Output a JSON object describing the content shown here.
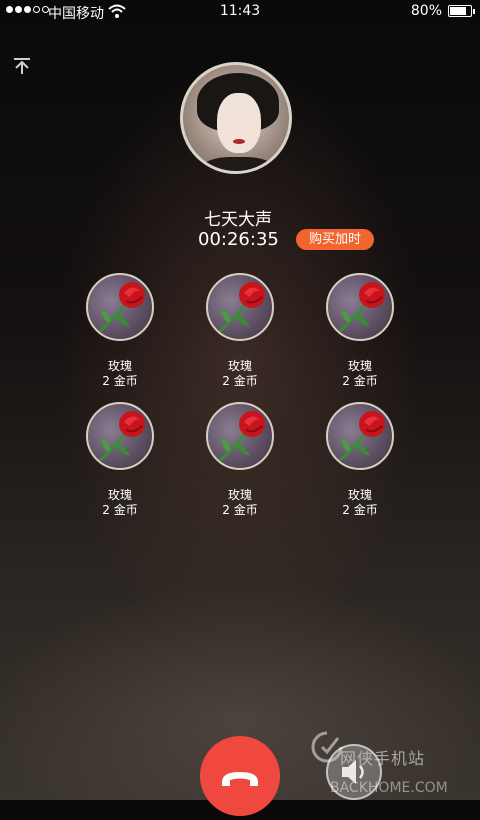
{
  "status_bar": {
    "carrier": "中国移动",
    "time": "11:43",
    "battery_percent": "80%",
    "battery_level": 0.8,
    "signal_bars_filled": 3,
    "signal_bars_total": 5,
    "wifi_icon": "wifi-icon"
  },
  "call": {
    "caller_name": "七天大声",
    "duration": "00:26:35",
    "buy_time_label": "购买加时"
  },
  "gifts": [
    {
      "name": "玫瑰",
      "price": "2 金币",
      "icon": "rose-icon"
    },
    {
      "name": "玫瑰",
      "price": "2 金币",
      "icon": "rose-icon"
    },
    {
      "name": "玫瑰",
      "price": "2 金币",
      "icon": "rose-icon"
    },
    {
      "name": "玫瑰",
      "price": "2 金币",
      "icon": "rose-icon"
    },
    {
      "name": "玫瑰",
      "price": "2 金币",
      "icon": "rose-icon"
    },
    {
      "name": "玫瑰",
      "price": "2 金币",
      "icon": "rose-icon"
    }
  ],
  "controls": {
    "hangup_icon": "phone-hangup-icon",
    "speaker_icon": "speaker-icon",
    "minimize_icon": "minimize-icon"
  },
  "watermark": {
    "title": "网侠手机站",
    "url": "BACKHOME.COM"
  },
  "colors": {
    "accent": "#f2652f",
    "hangup": "#f0473f"
  }
}
